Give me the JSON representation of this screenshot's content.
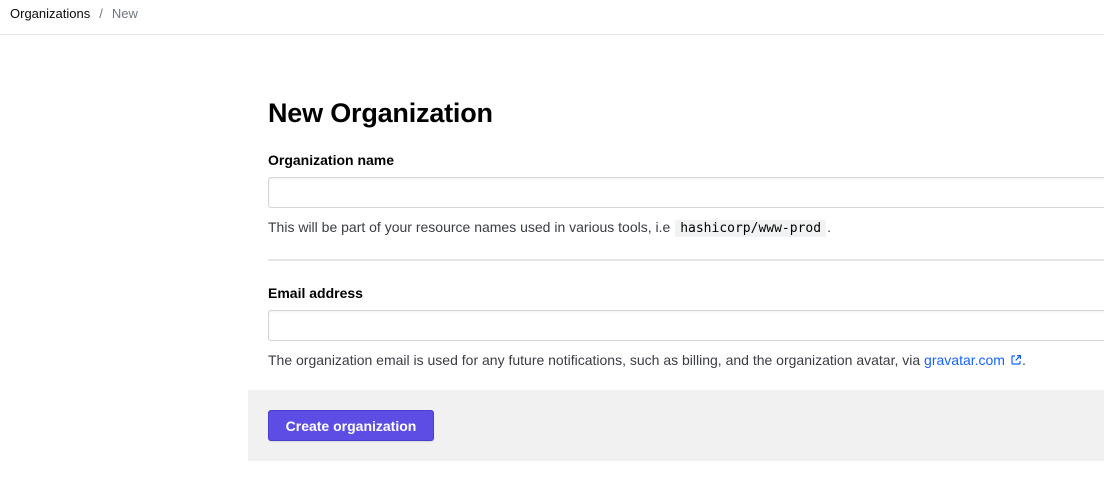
{
  "breadcrumb": {
    "parent": "Organizations",
    "separator": "/",
    "current": "New"
  },
  "page": {
    "title": "New Organization"
  },
  "form": {
    "org_name": {
      "label": "Organization name",
      "value": "",
      "placeholder": "",
      "help_prefix": "This will be part of your resource names used in various tools, i.e",
      "help_code": "hashicorp/www-prod",
      "help_suffix": "."
    },
    "email": {
      "label": "Email address",
      "value": "",
      "placeholder": "",
      "help_prefix": "The organization email is used for any future notifications, such as billing, and the organization avatar, via",
      "help_link": "gravatar.com",
      "help_suffix": "."
    },
    "submit_label": "Create organization"
  },
  "icons": {
    "external": "external-link-icon"
  },
  "colors": {
    "primary_button": "#5c4ee5",
    "link": "#1563ff",
    "footer_bg": "#f1f1f1"
  }
}
